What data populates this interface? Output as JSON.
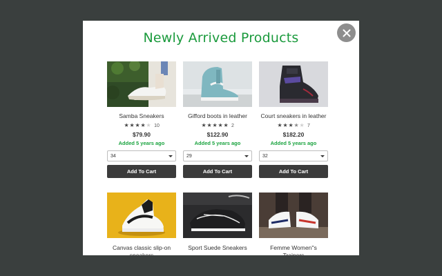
{
  "modal": {
    "title": "Newly Arrived Products",
    "close_icon": "close-icon"
  },
  "products": [
    {
      "name": "Samba Sneakers",
      "rating": 4,
      "reviews": "10",
      "price": "$79.90",
      "added": "Added 5 years ago",
      "size": "34",
      "cart_label": "Add To Cart"
    },
    {
      "name": "Gifford boots in leather",
      "rating": 5,
      "reviews": "2",
      "price": "$122.90",
      "added": "Added 5 years ago",
      "size": "29",
      "cart_label": "Add To Cart"
    },
    {
      "name": "Court sneakers in leather",
      "rating": 3.5,
      "reviews": "7",
      "price": "$182.20",
      "added": "Added 5 years ago",
      "size": "32",
      "cart_label": "Add To Cart"
    },
    {
      "name": "Canvas classic slip-on sneakers"
    },
    {
      "name": "Sport Suede Sneakers"
    },
    {
      "name": "Femme Women''s Trainers"
    }
  ],
  "colors": {
    "accent": "#1a9a3c",
    "added_green": "#1aa33f",
    "button_dark": "#3b3b3b",
    "backdrop": "#3a3f3e"
  }
}
